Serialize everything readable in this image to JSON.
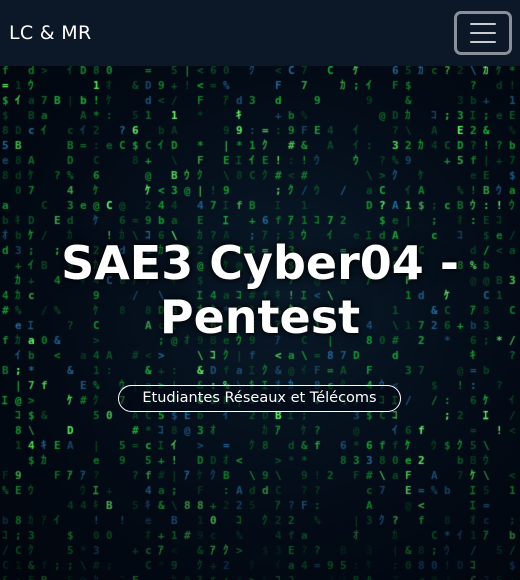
{
  "navbar": {
    "brand": "LC & MR",
    "toggler_icon": "hamburger-menu-icon"
  },
  "hero": {
    "title": "SAE3 Cyber04 - Pentest",
    "tagline": "Etudiantes Réseaux et Télécoms",
    "background": "matrix-digital-rain",
    "colors": {
      "rain_bright": "#6cff6c",
      "rain_mid": "#1fae3a",
      "rain_dim": "#0f5a2a",
      "rain_blue": "#2a6a9a"
    }
  },
  "colors": {
    "navbar_bg": "#0c1828",
    "page_bg": "#020814",
    "text": "#ffffff"
  }
}
